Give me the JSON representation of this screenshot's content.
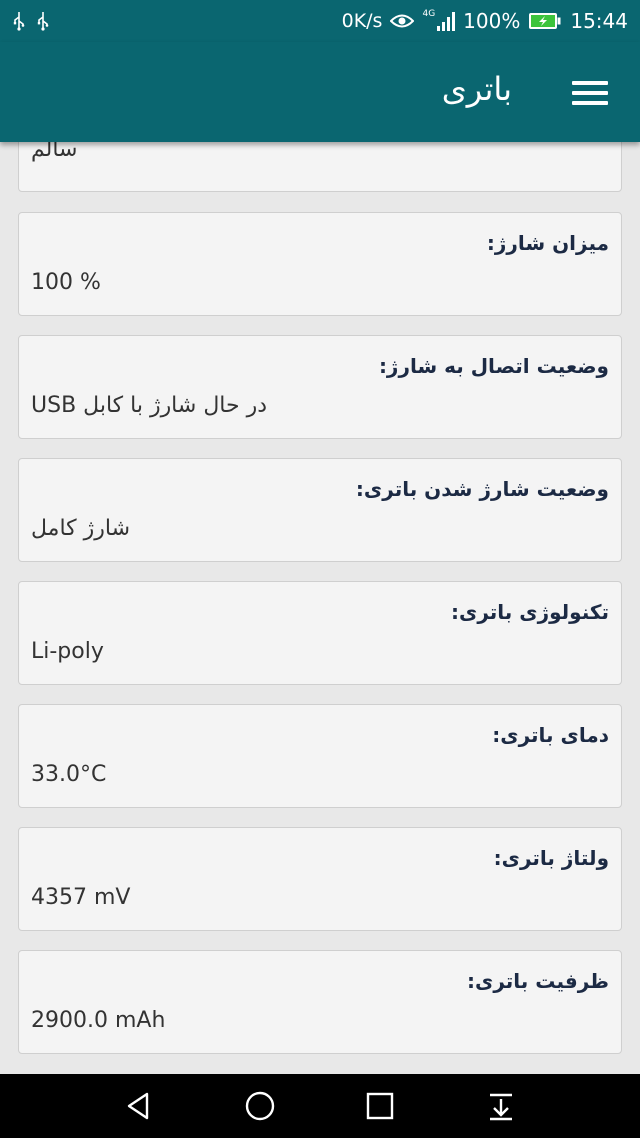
{
  "status_bar": {
    "speed": "0K/s",
    "network": "4G",
    "battery": "100%",
    "time": "15:44",
    "icons": [
      "usb-icon",
      "usb-icon",
      "eye-icon",
      "signal-icon",
      "battery-charging-icon"
    ]
  },
  "app_bar": {
    "title": "باتری",
    "menu_icon": "menu-icon"
  },
  "colors": {
    "primary": "#0a6670",
    "card_background": "#f4f4f4",
    "label_text": "#1c2a44",
    "battery_fill": "#3cc43c"
  },
  "partial_card": {
    "value": "سالم"
  },
  "cards": [
    {
      "label": "میزان شارژ:",
      "value": "100 %"
    },
    {
      "label": "وضعیت اتصال به شارژ:",
      "value": "در حال شارژ با کابل USB"
    },
    {
      "label": "وضعیت شارژ شدن باتری:",
      "value": "شارژ کامل"
    },
    {
      "label": "تکنولوژی باتری:",
      "value": "Li-poly"
    },
    {
      "label": "دمای باتری:",
      "value": "33.0°C"
    },
    {
      "label": "ولتاژ باتری:",
      "value": "4357 mV"
    },
    {
      "label": "ظرفیت باتری:",
      "value": "2900.0 mAh"
    }
  ],
  "nav_bar": {
    "icons": [
      "back-icon",
      "home-icon",
      "recents-icon",
      "notifications-pull-icon"
    ]
  }
}
